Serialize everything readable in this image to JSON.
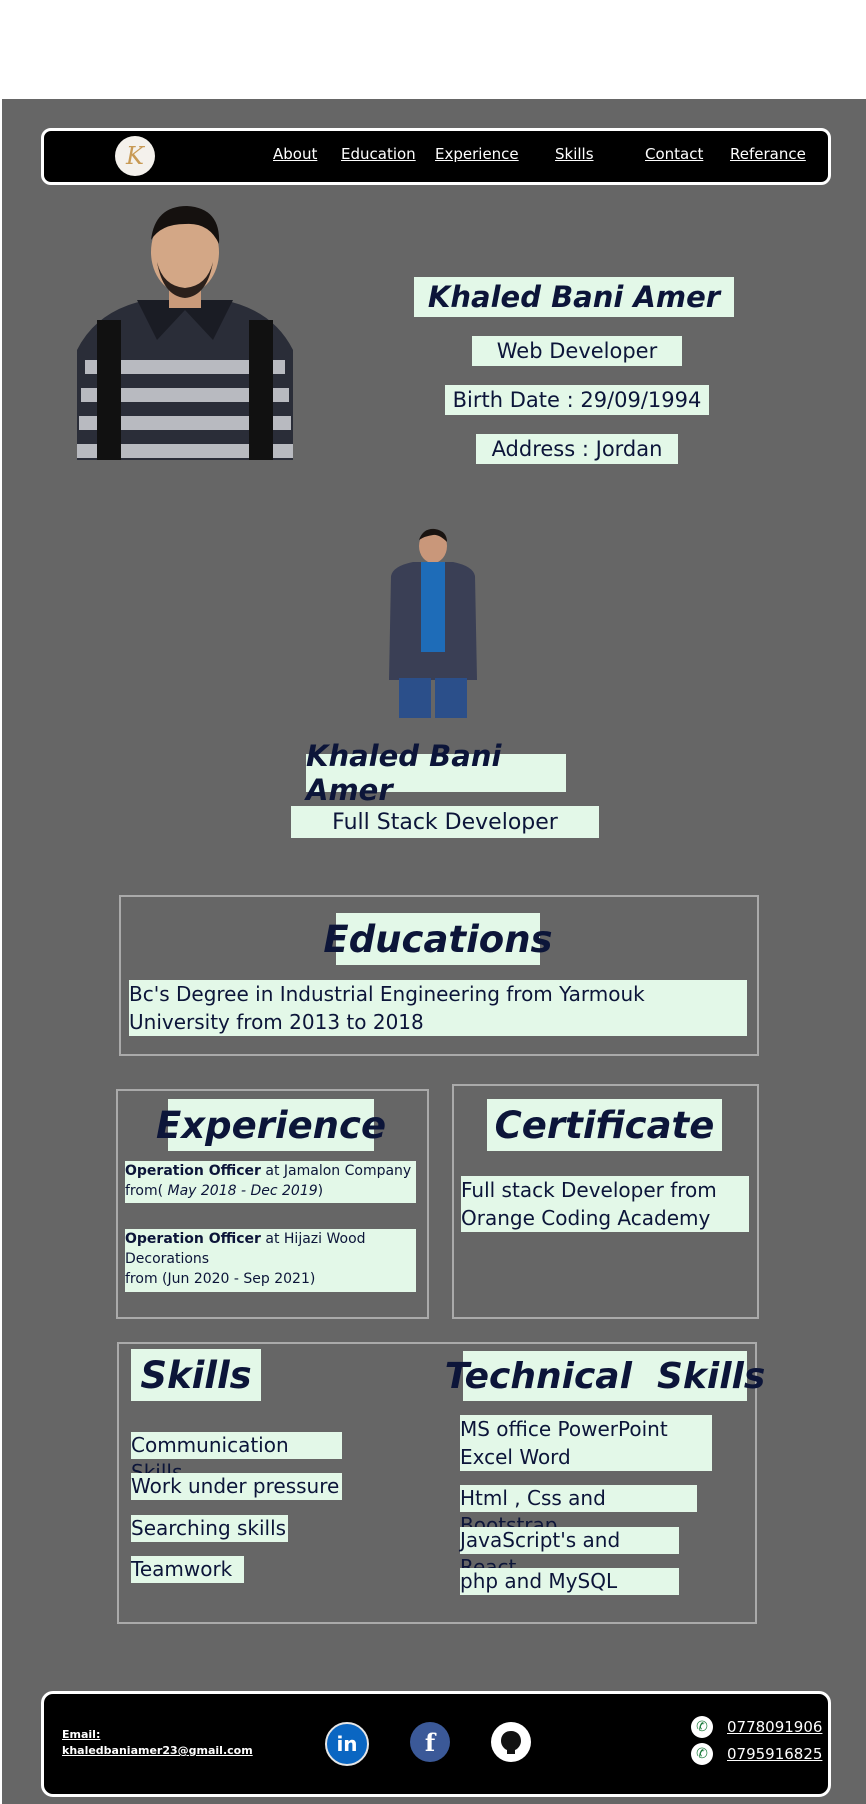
{
  "nav": {
    "logo_text": "K",
    "links": [
      "About",
      "Education",
      "Experience",
      "Skills",
      "Contact",
      "Referance"
    ]
  },
  "hero": {
    "name": "Khaled Bani Amer",
    "title": "Web Developer",
    "birth": "Birth Date : 29/09/1994",
    "address": "Address : Jordan"
  },
  "profile": {
    "name": "Khaled Bani Amer",
    "title": "Full Stack Developer"
  },
  "education": {
    "heading": "Educations",
    "text": "Bc's Degree in Industrial Engineering from Yarmouk University from 2013 to 2018"
  },
  "experience": {
    "heading": "Experience",
    "items": [
      {
        "role": "Operation Officer",
        "at": " at Jamalon Company",
        "from_prefix": "from(",
        "dates": " May 2018 - Dec 2019",
        "from_suffix": ")"
      },
      {
        "role": "Operation Officer",
        "at": " at Hijazi Wood Decorations",
        "from_line": "from (Jun 2020 - Sep 2021)"
      }
    ]
  },
  "certificate": {
    "heading": "Certificate",
    "text": "Full stack Developer from Orange Coding Academy"
  },
  "skills": {
    "heading": "Skills",
    "items": [
      "Communication Skills",
      "Work under pressure",
      "Searching skills",
      "Teamwork"
    ]
  },
  "technical": {
    "heading": "Technical  Skills",
    "items": [
      "MS office PowerPoint Excel Word",
      "Html , Css and Bootstrap",
      "JavaScript's and React",
      "php and MySQL"
    ]
  },
  "footer": {
    "email_label": "Email:",
    "email": "khaledbaniamer23@gmail.com",
    "phones": [
      "0778091906",
      "0795916825"
    ],
    "social": [
      {
        "name": "linkedin-icon",
        "glyph": "in",
        "color": "#0a66c2"
      },
      {
        "name": "facebook-icon",
        "glyph": "f",
        "color": "#3b5998"
      },
      {
        "name": "github-icon",
        "glyph": "⌘",
        "color": "#ffffff"
      }
    ]
  }
}
